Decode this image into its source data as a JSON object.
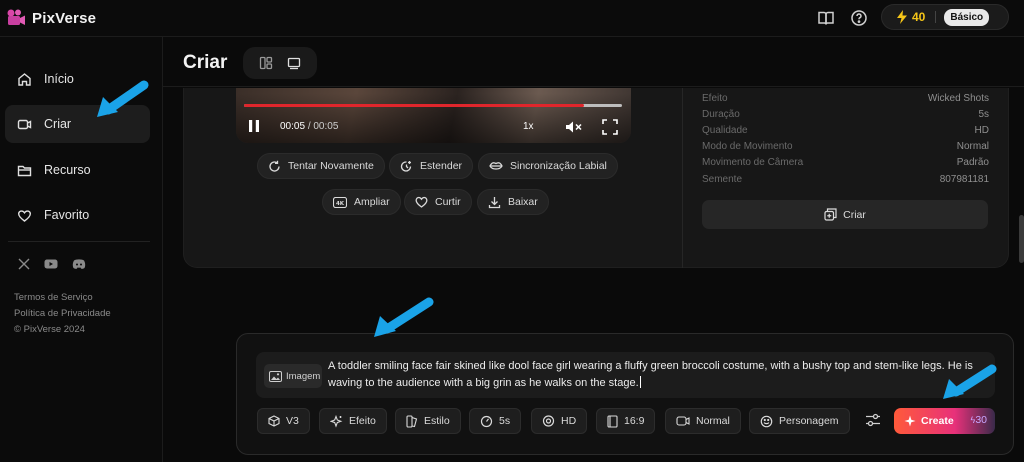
{
  "app": {
    "name": "PixVerse"
  },
  "header": {
    "credits": "40",
    "plan": "Básico"
  },
  "sidebar": {
    "items": [
      {
        "label": "Início"
      },
      {
        "label": "Criar"
      },
      {
        "label": "Recurso"
      },
      {
        "label": "Favorito"
      }
    ],
    "footer": {
      "terms": "Termos de Serviço",
      "privacy": "Política de Privacidade",
      "copyright": "© PixVerse 2024"
    }
  },
  "page": {
    "title": "Criar"
  },
  "video": {
    "current_time": "00:05",
    "duration": "00:05",
    "speed": "1x",
    "progress_fraction": 0.9
  },
  "actions": {
    "row1": [
      "Tentar Novamente",
      "Estender",
      "Sincronização Labial"
    ],
    "row2": [
      "Ampliar",
      "Curtir",
      "Baixar"
    ]
  },
  "details": [
    {
      "label": "Efeito",
      "value": "Wicked Shots"
    },
    {
      "label": "Duração",
      "value": "5s"
    },
    {
      "label": "Qualidade",
      "value": "HD"
    },
    {
      "label": "Modo de Movimento",
      "value": "Normal"
    },
    {
      "label": "Movimento de Câmera",
      "value": "Padrão"
    },
    {
      "label": "Semente",
      "value": "807981181"
    }
  ],
  "details_button": "Criar",
  "prompt": {
    "image_chip": "Imagem",
    "text": "A toddler smiling face fair skined like dool face girl wearing a fluffy green broccoli costume, with a bushy top and stem-like legs. He is waving to the audience with a big grin as he walks on the stage."
  },
  "options": {
    "model": "V3",
    "effect": "Efeito",
    "style": "Estilo",
    "duration": "5s",
    "quality": "HD",
    "ratio": "16:9",
    "motion": "Normal",
    "character": "Personagem"
  },
  "create": {
    "label": "Create",
    "cost": "30"
  },
  "colors": {
    "accent": "#e0262c",
    "credits": "#f5c518",
    "annotation_arrow": "#1aa3e8"
  }
}
